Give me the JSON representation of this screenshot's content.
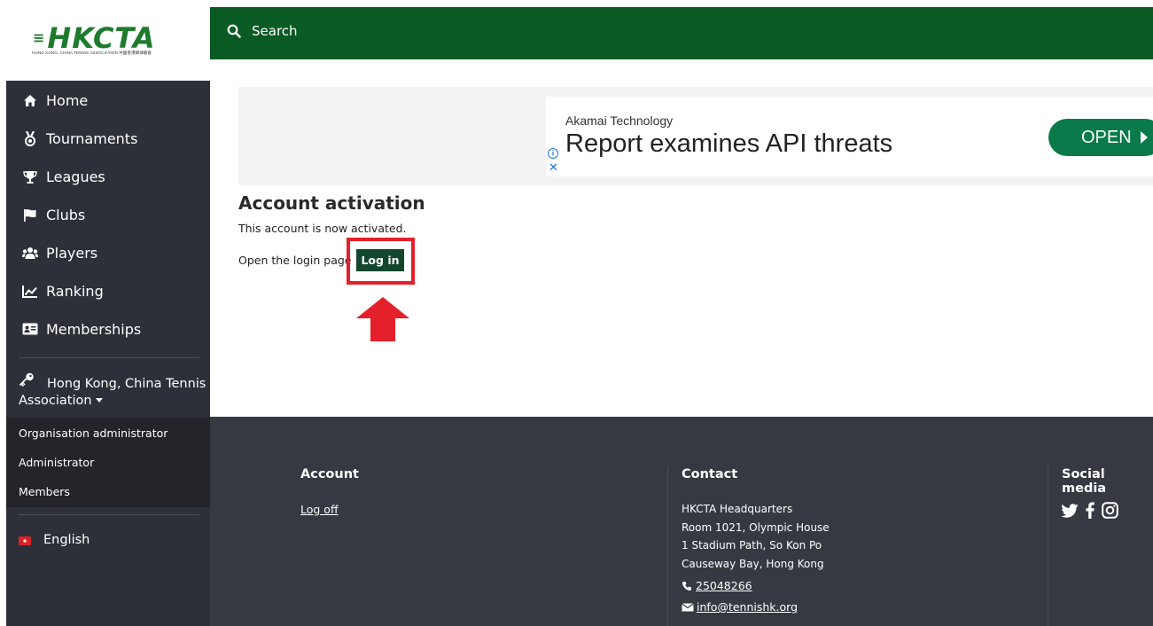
{
  "logo": {
    "mark": "HKCTA",
    "subtitle": "HONG KONG, CHINA TENNIS ASSOCIATION 中國香港網球總會"
  },
  "topbar": {
    "search_label": "Search"
  },
  "sidebar": {
    "items": [
      {
        "label": "Home",
        "icon": "home-icon"
      },
      {
        "label": "Tournaments",
        "icon": "medal-icon"
      },
      {
        "label": "Leagues",
        "icon": "trophy-icon"
      },
      {
        "label": "Clubs",
        "icon": "flag-icon"
      },
      {
        "label": "Players",
        "icon": "users-icon"
      },
      {
        "label": "Ranking",
        "icon": "line-chart-icon"
      },
      {
        "label": "Memberships",
        "icon": "id-card-icon"
      }
    ],
    "organisation": "Hong Kong, China Tennis Association",
    "admin_items": [
      "Organisation administrator",
      "Administrator",
      "Members"
    ],
    "language": "English"
  },
  "ad": {
    "brand": "Akamai Technology",
    "headline": "Report examines API threats",
    "cta": "OPEN",
    "info_glyph": "i",
    "close_glyph": "✕"
  },
  "main": {
    "title": "Account activation",
    "message": "This account is now activated.",
    "login_prompt": "Open the login page",
    "login_button": "Log in"
  },
  "footer": {
    "account_title": "Account",
    "logoff": "Log off",
    "contact_title": "Contact",
    "address": [
      "HKCTA Headquarters",
      "Room 1021, Olympic House",
      "1 Stadium Path, So Kon Po",
      "Causeway Bay, Hong Kong"
    ],
    "phone": "25048266",
    "email": "info@tennishk.org",
    "social_title": "Social media"
  },
  "colors": {
    "brand_green": "#0a5a23",
    "sidebar_bg": "#2d3038",
    "footer_bg": "#363942",
    "highlight_red": "#e4202b",
    "button_green": "#13472d"
  }
}
